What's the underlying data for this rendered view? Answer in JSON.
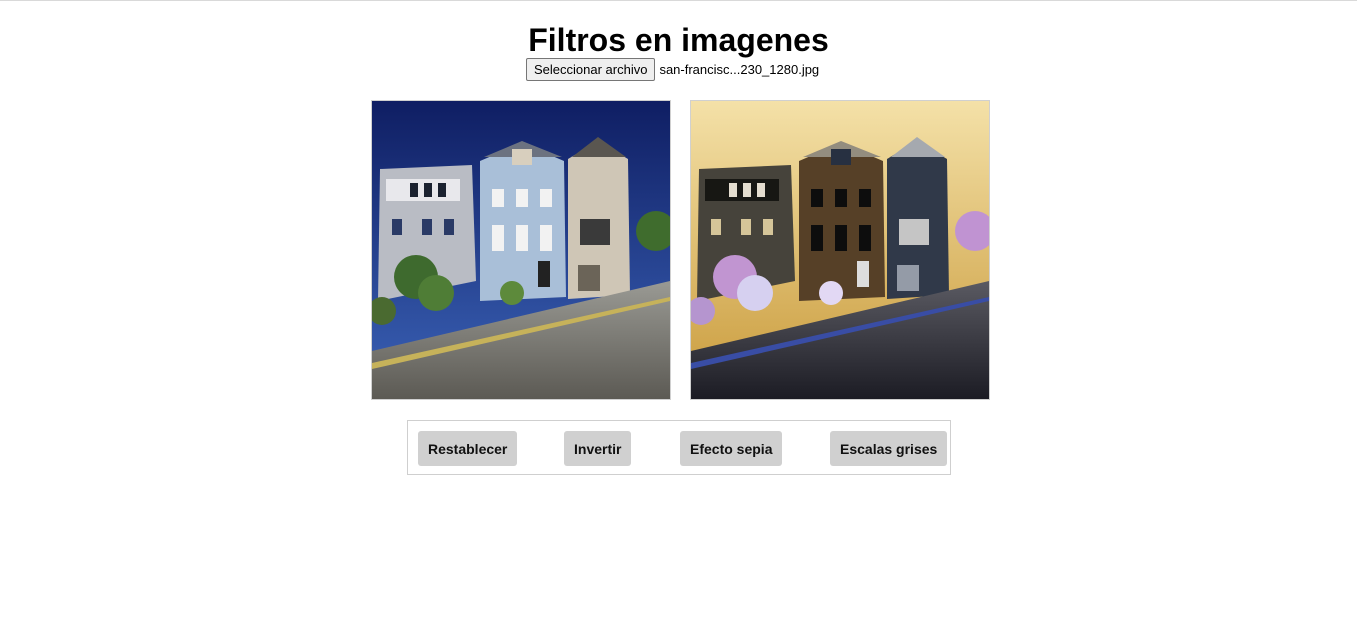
{
  "page": {
    "title": "Filtros en imagenes"
  },
  "file_input": {
    "button_label": "Seleccionar archivo",
    "file_name": "san-francisc...230_1280.jpg"
  },
  "images": {
    "original_name": "house-row-photo",
    "filtered_name": "house-row-photo-inverted"
  },
  "filters": {
    "reset_label": "Restablecer",
    "invert_label": "Invertir",
    "sepia_label": "Efecto sepia",
    "grayscale_label": "Escalas grises"
  }
}
